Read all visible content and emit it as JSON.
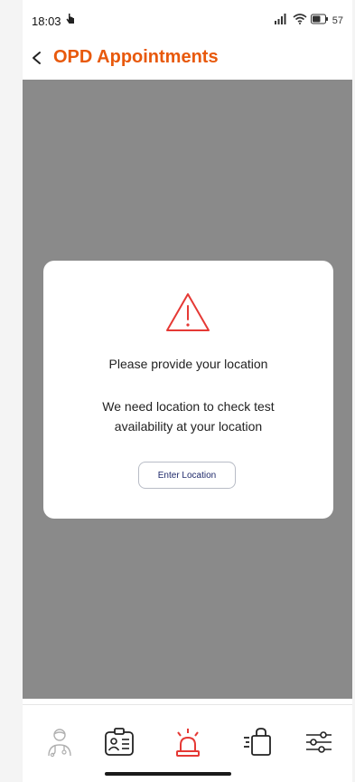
{
  "status_bar": {
    "time": "18:03",
    "battery": "57"
  },
  "header": {
    "title": "OPD Appointments"
  },
  "modal": {
    "title": "Please provide your location",
    "message": "We need location to check test availability at your location",
    "button_label": "Enter Location"
  },
  "bottom_nav": {
    "items": [
      {
        "icon": "doctor-icon",
        "active": false
      },
      {
        "icon": "id-card-icon",
        "active": false
      },
      {
        "icon": "siren-icon",
        "active": true
      },
      {
        "icon": "shopping-bag-icon",
        "active": false
      },
      {
        "icon": "sliders-icon",
        "active": false
      }
    ]
  },
  "colors": {
    "accent": "#e8590c",
    "alert_red": "#e53935",
    "overlay_grey": "#8a8a8a",
    "button_text": "#1f2a6b"
  }
}
